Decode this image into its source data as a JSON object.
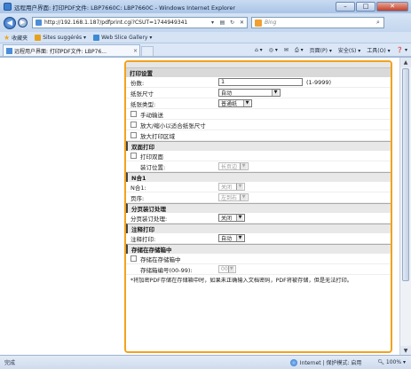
{
  "window": {
    "title": "远程用户界面: 打印PDF文件: LBP7660C: LBP7660C - Windows Internet Explorer",
    "btn_min": "–",
    "btn_max": "□",
    "btn_close": "✕"
  },
  "address": {
    "url": "http://192.168.1.187/pdfprint.cgi?CSUT=1744949341",
    "search_placeholder": "Bing"
  },
  "favorites": {
    "label": "收藏夹",
    "items": [
      "Sites suggérés ▾",
      "Web Slice Gallery ▾"
    ]
  },
  "tab": {
    "label": "远程用户界面: 打印PDF文件: LBP76..."
  },
  "commandbar": {
    "items": [
      "页面(P) ▾",
      "安全(S) ▾",
      "工具(O) ▾",
      "❓ ▾"
    ]
  },
  "form": {
    "print_settings": {
      "header": "打印设置",
      "copies_label": "份数:",
      "copies_value": "1",
      "copies_range": "(1-9999)",
      "paper_size_label": "纸张尺寸",
      "paper_size_value": "自动",
      "paper_type_label": "纸张类型:",
      "paper_type_value": "普通纸",
      "manual_feed_label": "手动输送",
      "fit_page_label": "放大/缩小以适合纸张尺寸",
      "enlarge_area_label": "放大打印区域"
    },
    "duplex": {
      "header": "双面打印",
      "duplex_label": "打印双面",
      "binding_label": "装订位置:",
      "binding_value": "长页边"
    },
    "n_up": {
      "header": "N合1",
      "n_up_label": "N合1:",
      "n_up_value": "关闭",
      "order_label": "页序:",
      "order_value": "左到右"
    },
    "collate": {
      "header": "分页装订处理",
      "collate_label": "分页装订处理:",
      "collate_value": "关闭"
    },
    "annotation": {
      "header": "注释打印",
      "annotation_label": "注释打印:",
      "annotation_value": "自动"
    },
    "mailbox": {
      "header": "存储在存储箱中",
      "store_label": "存储在存储箱中",
      "box_number_label": "存储箱编号(00-99):",
      "box_number_value": "00",
      "note": "*将加密PDF存储在存储箱中时，如果未正确输入文档密码，PDF将被存储，但是无法打印。"
    }
  },
  "status": {
    "left": "完成",
    "zone": "Internet | 保护模式: 启用",
    "zoom": "100%"
  }
}
